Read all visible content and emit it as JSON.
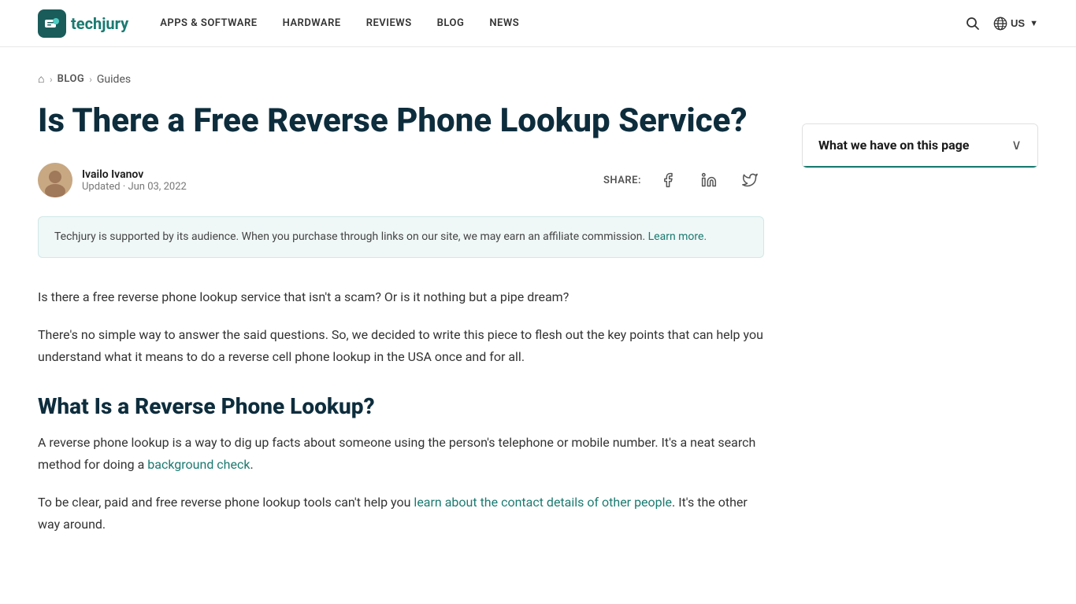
{
  "site": {
    "logo_text_1": "tech",
    "logo_text_2": "jury"
  },
  "nav": {
    "items": [
      {
        "label": "APPS & SOFTWARE",
        "id": "apps-software"
      },
      {
        "label": "HARDWARE",
        "id": "hardware"
      },
      {
        "label": "REVIEWS",
        "id": "reviews"
      },
      {
        "label": "BLOG",
        "id": "blog"
      },
      {
        "label": "NEWS",
        "id": "news"
      }
    ]
  },
  "header": {
    "region": "US",
    "search_label": "Search"
  },
  "breadcrumb": {
    "home": "Home",
    "blog": "Blog",
    "section": "Guides"
  },
  "article": {
    "title": "Is There a Free Reverse Phone Lookup Service?",
    "author": {
      "name": "Ivailo Ivanov",
      "date_label": "Updated · Jun 03, 2022"
    },
    "share_label": "SHARE:",
    "disclaimer": "Techjury is supported by its audience. When you purchase through links on our site, we may earn an affiliate commission.",
    "disclaimer_link": "Learn more.",
    "intro_p1": "Is there a free reverse phone lookup service that isn't a scam? Or is it nothing but a pipe dream?",
    "intro_p2": "There's no simple way to answer the said questions. So, we decided to write this piece to flesh out the key points that can help you understand what it means to do a reverse cell phone lookup in the USA once and for all.",
    "section1_heading": "What Is a Reverse Phone Lookup?",
    "section1_p1": "A reverse phone lookup is a way to dig up facts about someone using the person's telephone or mobile number. It's a neat search method for doing a",
    "section1_p1_link_text": "background check",
    "section1_p1_after": ".",
    "section1_p2_before": "To be clear, paid and free reverse phone lookup tools can't help you",
    "section1_p2_link_text": "learn about the contact details of other people",
    "section1_p2_after": ". It's the other way around."
  },
  "toc": {
    "title": "What we have on this page",
    "chevron": "∨"
  },
  "colors": {
    "brand_teal": "#1a7a70",
    "dark_navy": "#0d2d3d",
    "disclaimer_bg": "#f0f7f7"
  }
}
